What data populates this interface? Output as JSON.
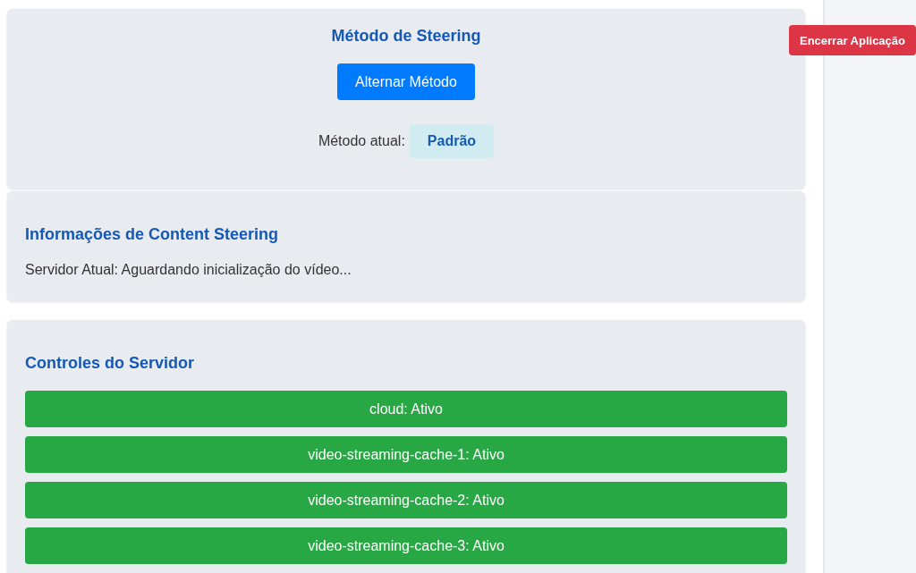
{
  "steering_method": {
    "title": "Método de Steering",
    "toggle_button": "Alternar Método",
    "current_label": "Método atual:",
    "current_value": "Padrão"
  },
  "steering_info": {
    "title": "Informações de Content Steering",
    "text": "Servidor Atual: Aguardando inicialização do vídeo..."
  },
  "server_controls": {
    "title": "Controles do Servidor",
    "servers": [
      {
        "label": "cloud: Ativo",
        "active": true
      },
      {
        "label": "video-streaming-cache-1: Ativo",
        "active": true
      },
      {
        "label": "video-streaming-cache-2: Ativo",
        "active": true
      },
      {
        "label": "video-streaming-cache-3: Ativo",
        "active": true
      }
    ]
  },
  "exit_button": "Encerrar Aplicação"
}
